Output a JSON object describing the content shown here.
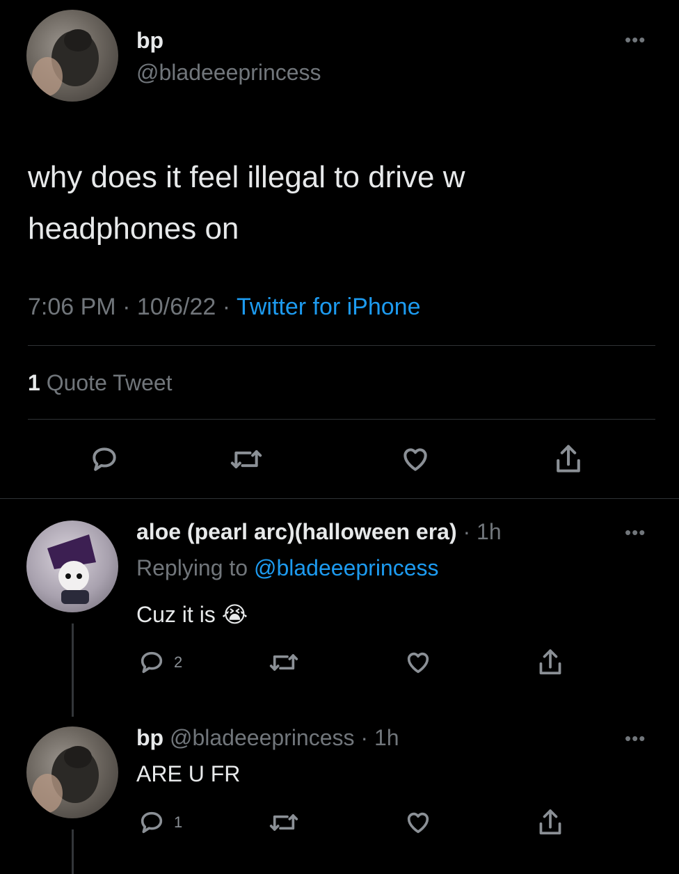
{
  "main_tweet": {
    "display_name": "bp",
    "handle": "@bladeeeprincess",
    "text_line1": "why does it feel illegal to drive w",
    "text_line2": "headphones on",
    "time": "7:06 PM",
    "date": "10/6/22",
    "source": "Twitter for iPhone",
    "separator": "·",
    "quote_count": "1",
    "quote_label": "Quote Tweet"
  },
  "reply1": {
    "display_name": "aloe (pearl arc)(halloween era)",
    "time_ago": "1h",
    "separator": "·",
    "replying_prefix": "Replying to",
    "replying_handle": "@bladeeeprincess",
    "text": "Cuz it is",
    "emoji": "😭",
    "reply_count": "2"
  },
  "reply2": {
    "display_name": "bp",
    "handle": "@bladeeeprincess",
    "separator": "·",
    "time_ago": "1h",
    "text": "ARE U FR",
    "reply_count": "1"
  },
  "more_icon_glyph": "•••",
  "icons": [
    "reply-icon",
    "retweet-icon",
    "like-icon",
    "share-icon",
    "more-icon"
  ],
  "colors": {
    "background": "#000000",
    "text": "#e7e9ea",
    "muted": "#71767b",
    "link": "#1d9bf0"
  }
}
